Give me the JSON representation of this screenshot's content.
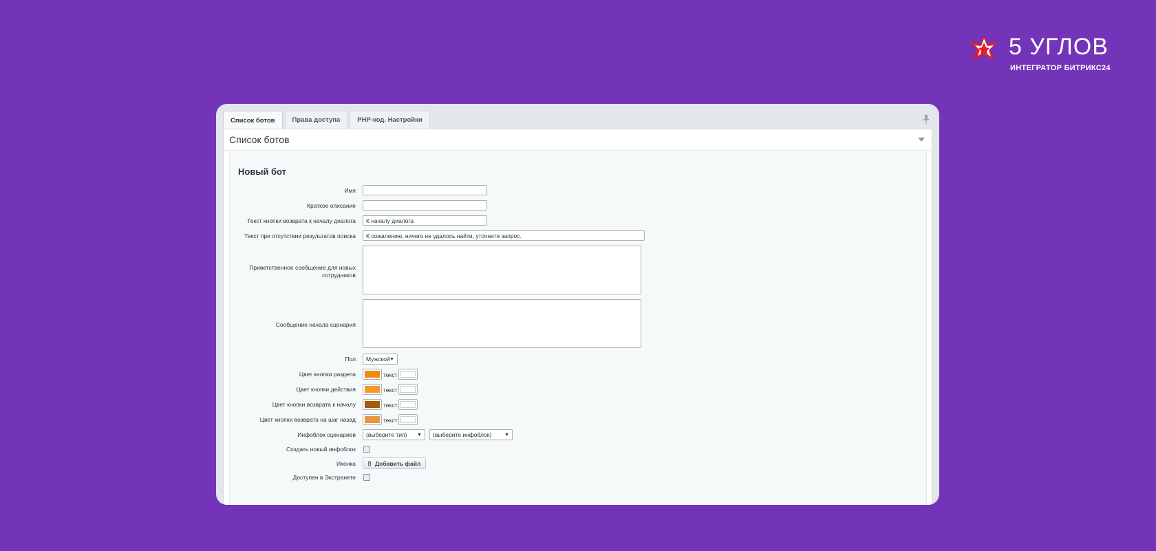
{
  "brand": {
    "title": "5 УГЛОВ",
    "subtitle": "ИНТЕГРАТОР БИТРИКС24",
    "star_color": "#e41e26"
  },
  "tabs": [
    {
      "label": "Список ботов",
      "active": true
    },
    {
      "label": "Права доступа",
      "active": false
    },
    {
      "label": "PHP-код. Настройки",
      "active": false
    }
  ],
  "panel": {
    "title": "Список ботов"
  },
  "form": {
    "title": "Новый бот",
    "name": {
      "label": "Имя",
      "value": ""
    },
    "short_desc": {
      "label": "Краткое описание",
      "value": ""
    },
    "back_button_text": {
      "label": "Текст кнопки возврата к началу диалога",
      "value": "К началу диалога"
    },
    "no_results_text": {
      "label": "Текст при отсутствии результатов поиска",
      "value": "К сожалению, ничего не удалось найти, уточните запрос."
    },
    "welcome_message": {
      "label": "Приветственное сообщение для новых сотрудников",
      "value": ""
    },
    "scenario_start_message": {
      "label": "Сообщение начала сценария",
      "value": ""
    },
    "gender": {
      "label": "Пол",
      "value": "Мужской"
    },
    "text_label": "текст",
    "colors": [
      {
        "label": "Цвет кнопки раздела",
        "color": "#f08a12"
      },
      {
        "label": "Цвет кнопки действия",
        "color": "#f7992a"
      },
      {
        "label": "Цвет кнопки возврата к началу",
        "color": "#a85a0d"
      },
      {
        "label": "Цвет кнопки возврата на шаг назад",
        "color": "#e89440"
      }
    ],
    "infoblock": {
      "label": "Инфоблок сценариев",
      "type_value": "(выберите тип)",
      "block_value": "(выберите инфоблок)"
    },
    "create_infoblock": {
      "label": "Создать новый инфоблок",
      "checked": false
    },
    "icon": {
      "label": "Иконка",
      "button_label": "Добавить файл"
    },
    "extranet": {
      "label": "Доступен в Экстранете",
      "checked": false
    }
  }
}
